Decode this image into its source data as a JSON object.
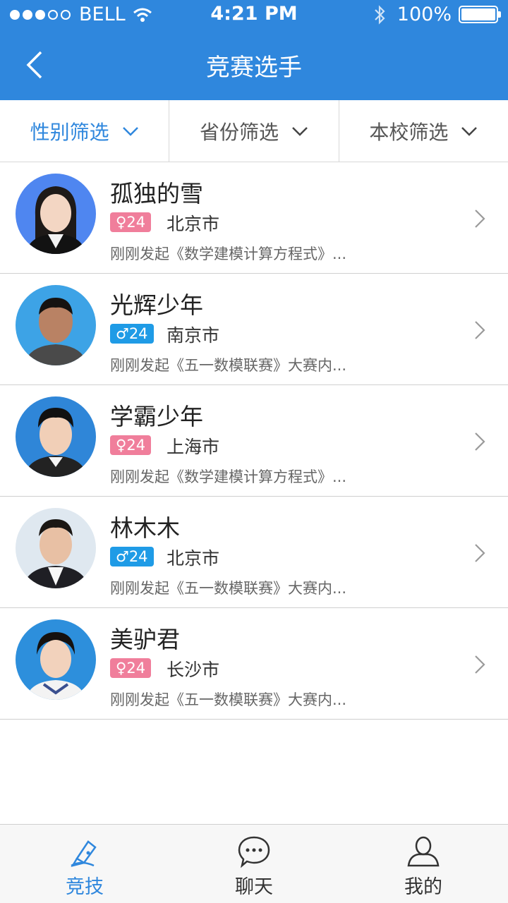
{
  "status": {
    "carrier": "BELL",
    "time": "4:21 PM",
    "battery": "100%",
    "signal_icons": [
      "signal-dots",
      "wifi-icon",
      "bluetooth-icon",
      "battery-icon"
    ]
  },
  "nav": {
    "title": "竞赛选手",
    "back_icon": "back-arrow-icon"
  },
  "filters": [
    {
      "label": "性别筛选",
      "active": true
    },
    {
      "label": "省份筛选",
      "active": false
    },
    {
      "label": "本校筛选",
      "active": false
    }
  ],
  "colors": {
    "accent": "#2f87dd",
    "female_badge": "#f07e9b",
    "male_badge": "#1f9be6"
  },
  "players": [
    {
      "name": "孤独的雪",
      "gender": "female",
      "age": "♀24",
      "city": "北京市",
      "desc": "刚刚发起《数学建模计算方程式》..."
    },
    {
      "name": "光辉少年",
      "gender": "male",
      "age": "♂24",
      "city": "南京市",
      "desc": "刚刚发起《五一数模联赛》大赛内..."
    },
    {
      "name": "学霸少年",
      "gender": "female",
      "age": "♀24",
      "city": "上海市",
      "desc": "刚刚发起《数学建模计算方程式》..."
    },
    {
      "name": "林木木",
      "gender": "male",
      "age": "♂24",
      "city": "北京市",
      "desc": "刚刚发起《五一数模联赛》大赛内..."
    },
    {
      "name": "美驴君",
      "gender": "female",
      "age": "♀24",
      "city": "长沙市",
      "desc": "刚刚发起《五一数模联赛》大赛内..."
    }
  ],
  "tabs": [
    {
      "label": "竞技",
      "icon": "pen-nib-icon",
      "active": true
    },
    {
      "label": "聊天",
      "icon": "chat-bubble-icon",
      "active": false
    },
    {
      "label": "我的",
      "icon": "user-icon",
      "active": false
    }
  ]
}
